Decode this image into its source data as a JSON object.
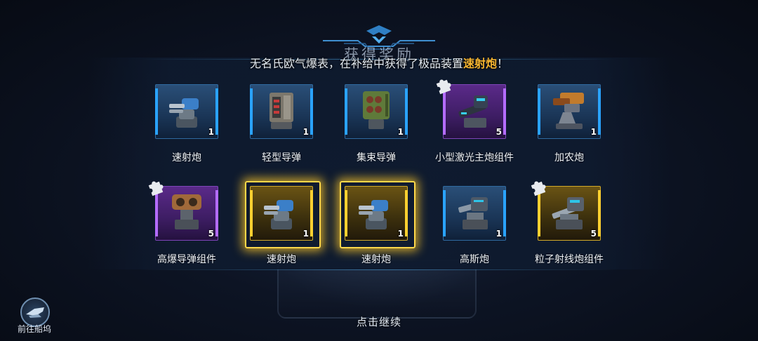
{
  "header": {
    "title": "获得奖励",
    "announcement_prefix": "无名氏欧气爆表，在补给中获得了极品装置",
    "announcement_highlight": "速射炮",
    "announcement_suffix": "！"
  },
  "rewards": [
    {
      "name": "速射炮",
      "count": "1",
      "rarity": "blue",
      "fragment": false,
      "glow": false
    },
    {
      "name": "轻型导弹",
      "count": "1",
      "rarity": "blue",
      "fragment": false,
      "glow": false
    },
    {
      "name": "集束导弹",
      "count": "1",
      "rarity": "blue",
      "fragment": false,
      "glow": false
    },
    {
      "name": "小型激光主炮组件",
      "count": "5",
      "rarity": "purple",
      "fragment": true,
      "glow": false
    },
    {
      "name": "加农炮",
      "count": "1",
      "rarity": "blue",
      "fragment": false,
      "glow": false
    },
    {
      "name": "高爆导弹组件",
      "count": "5",
      "rarity": "purple",
      "fragment": true,
      "glow": false
    },
    {
      "name": "速射炮",
      "count": "1",
      "rarity": "gold",
      "fragment": false,
      "glow": true
    },
    {
      "name": "速射炮",
      "count": "1",
      "rarity": "gold",
      "fragment": false,
      "glow": true
    },
    {
      "name": "高斯炮",
      "count": "1",
      "rarity": "blue",
      "fragment": false,
      "glow": false
    },
    {
      "name": "粒子射线炮组件",
      "count": "5",
      "rarity": "gold",
      "fragment": true,
      "glow": false
    }
  ],
  "dock_button": {
    "label": "前往船坞",
    "icon": "ship-icon"
  },
  "continue_text": "点击继续",
  "colors": {
    "highlight": "#f5b431",
    "blue_rarity": "#2aa3ff",
    "purple_rarity": "#b46cff",
    "gold_rarity": "#ffd030"
  }
}
